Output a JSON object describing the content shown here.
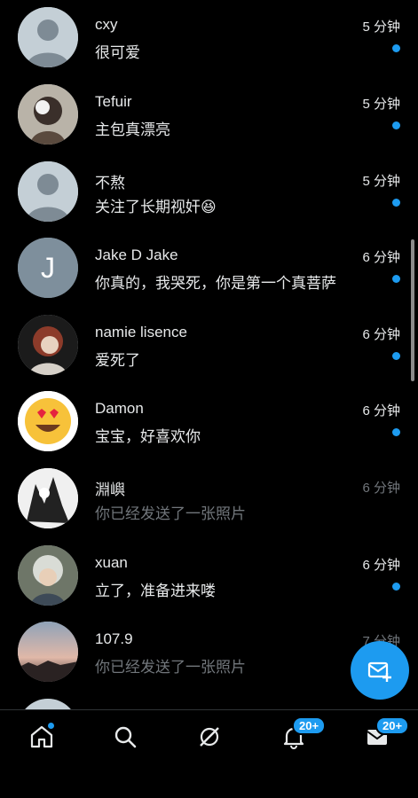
{
  "conversations": [
    {
      "name": "cxy",
      "preview": "很可爱",
      "time": "5 分钟",
      "unread": true,
      "avatar": "default-avatar"
    },
    {
      "name": "Tefuir",
      "preview": "主包真漂亮",
      "time": "5 分钟",
      "unread": true,
      "avatar": "anime-avatar"
    },
    {
      "name": "不熬",
      "preview": "关注了长期视奸😆",
      "time": "5 分钟",
      "unread": true,
      "avatar": "default-avatar"
    },
    {
      "name": "Jake D Jake",
      "preview": "你真的，我哭死，你是第一个真菩萨",
      "time": "6 分钟",
      "unread": true,
      "avatar": "letter-avatar",
      "letter": "J"
    },
    {
      "name": "namie lisence",
      "preview": "爱死了",
      "time": "6 分钟",
      "unread": true,
      "avatar": "anime-avatar"
    },
    {
      "name": "Damon",
      "preview": "宝宝，好喜欢你",
      "time": "6 分钟",
      "unread": true,
      "avatar": "heart-eyes-emoji-avatar"
    },
    {
      "name": "淵嶼",
      "preview": "你已经发送了一张照片",
      "time": "6 分钟",
      "unread": false,
      "avatar": "manga-avatar"
    },
    {
      "name": "xuan",
      "preview": "立了，准备进来喽",
      "time": "6 分钟",
      "unread": true,
      "avatar": "anime-avatar"
    },
    {
      "name": "107.9",
      "preview": "你已经发送了一张照片",
      "time": "7 分钟",
      "unread": false,
      "avatar": "sunset-photo-avatar"
    }
  ],
  "tabbar": {
    "notifications_badge": "20+",
    "messages_badge": "20+"
  },
  "colors": {
    "accent": "#1d9bf0",
    "background": "#000000",
    "muted": "#71767b"
  }
}
